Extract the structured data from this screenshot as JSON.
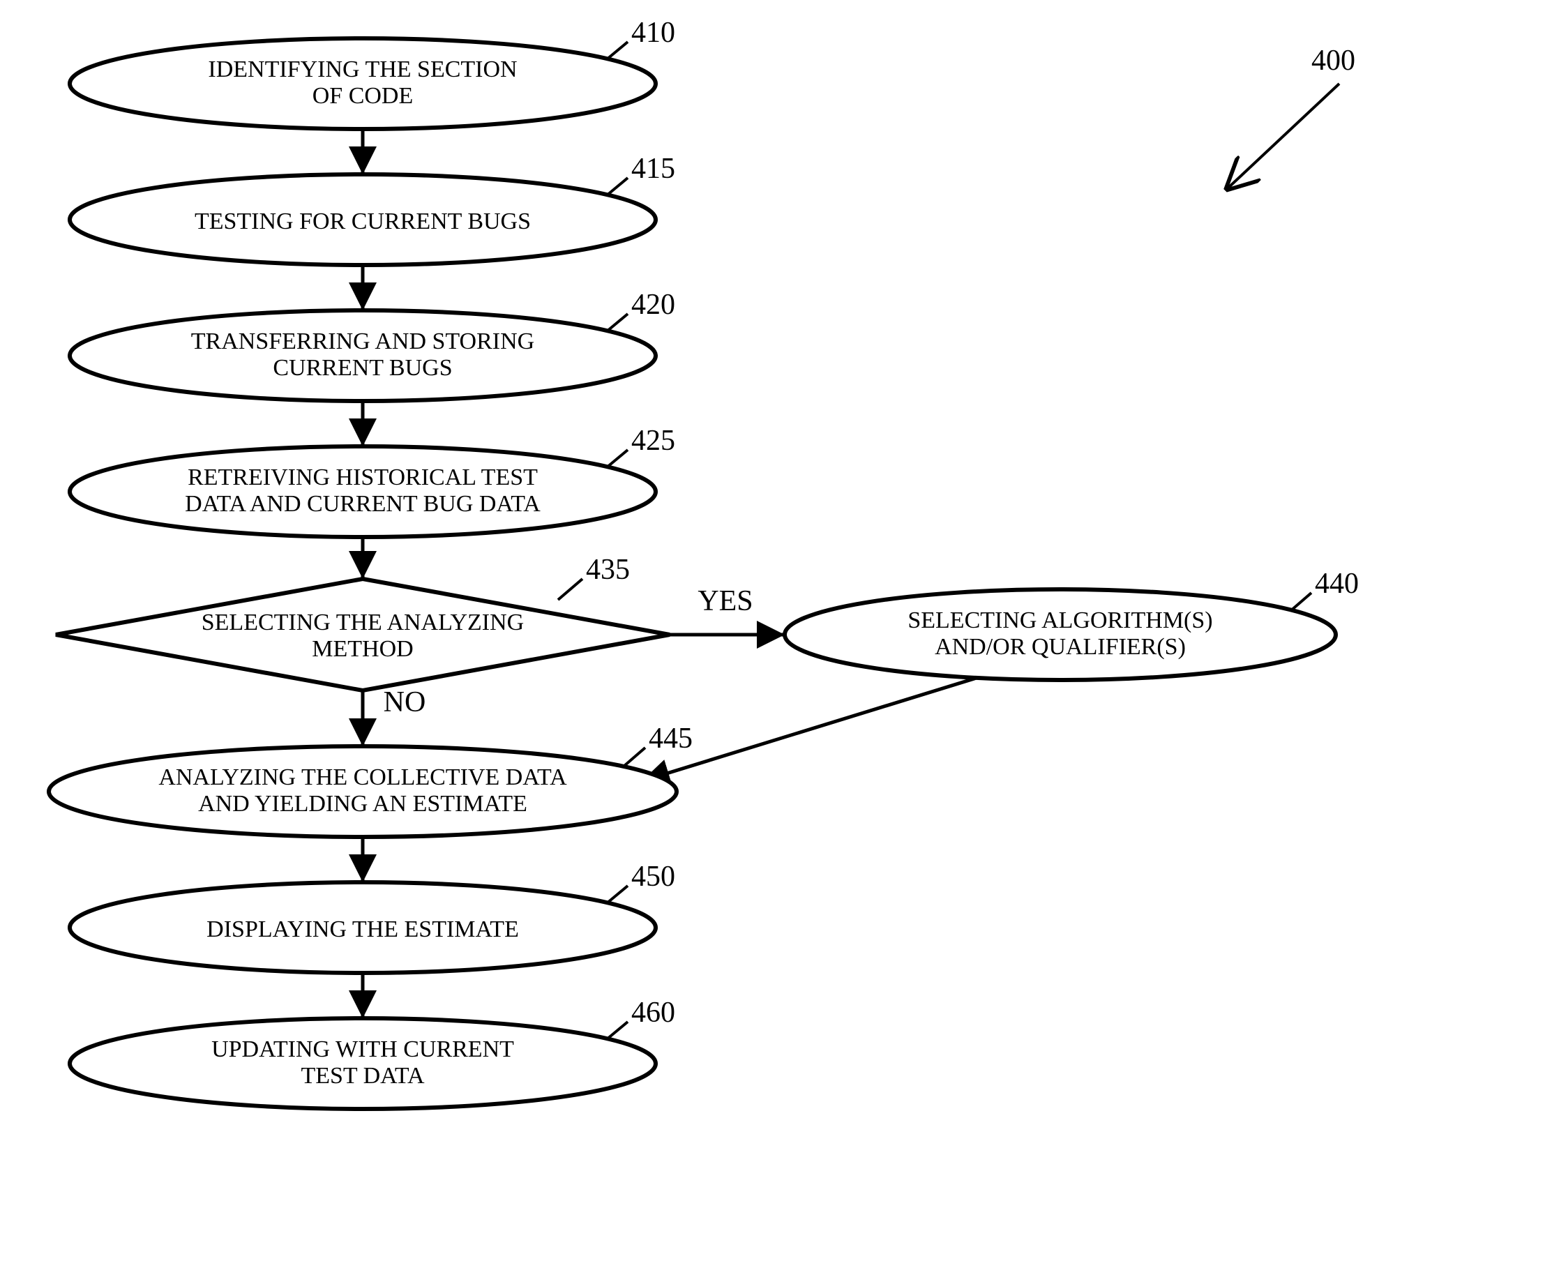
{
  "figure_ref": "400",
  "nodes": {
    "n410": {
      "ref": "410",
      "line1": "IDENTIFYING THE SECTION",
      "line2": "OF CODE"
    },
    "n415": {
      "ref": "415",
      "line1": "TESTING FOR CURRENT BUGS"
    },
    "n420": {
      "ref": "420",
      "line1": "TRANSFERRING AND STORING",
      "line2": "CURRENT BUGS"
    },
    "n425": {
      "ref": "425",
      "line1": "RETREIVING HISTORICAL TEST",
      "line2": "DATA AND CURRENT BUG DATA"
    },
    "n435": {
      "ref": "435",
      "line1": "SELECTING THE ANALYZING",
      "line2": "METHOD"
    },
    "n440": {
      "ref": "440",
      "line1": "SELECTING ALGORITHM(S)",
      "line2": "AND/OR QUALIFIER(S)"
    },
    "n445": {
      "ref": "445",
      "line1": "ANALYZING THE COLLECTIVE DATA",
      "line2": "AND YIELDING AN ESTIMATE"
    },
    "n450": {
      "ref": "450",
      "line1": "DISPLAYING THE ESTIMATE"
    },
    "n460": {
      "ref": "460",
      "line1": "UPDATING WITH CURRENT",
      "line2": "TEST DATA"
    }
  },
  "edges": {
    "yes": "YES",
    "no": "NO"
  }
}
